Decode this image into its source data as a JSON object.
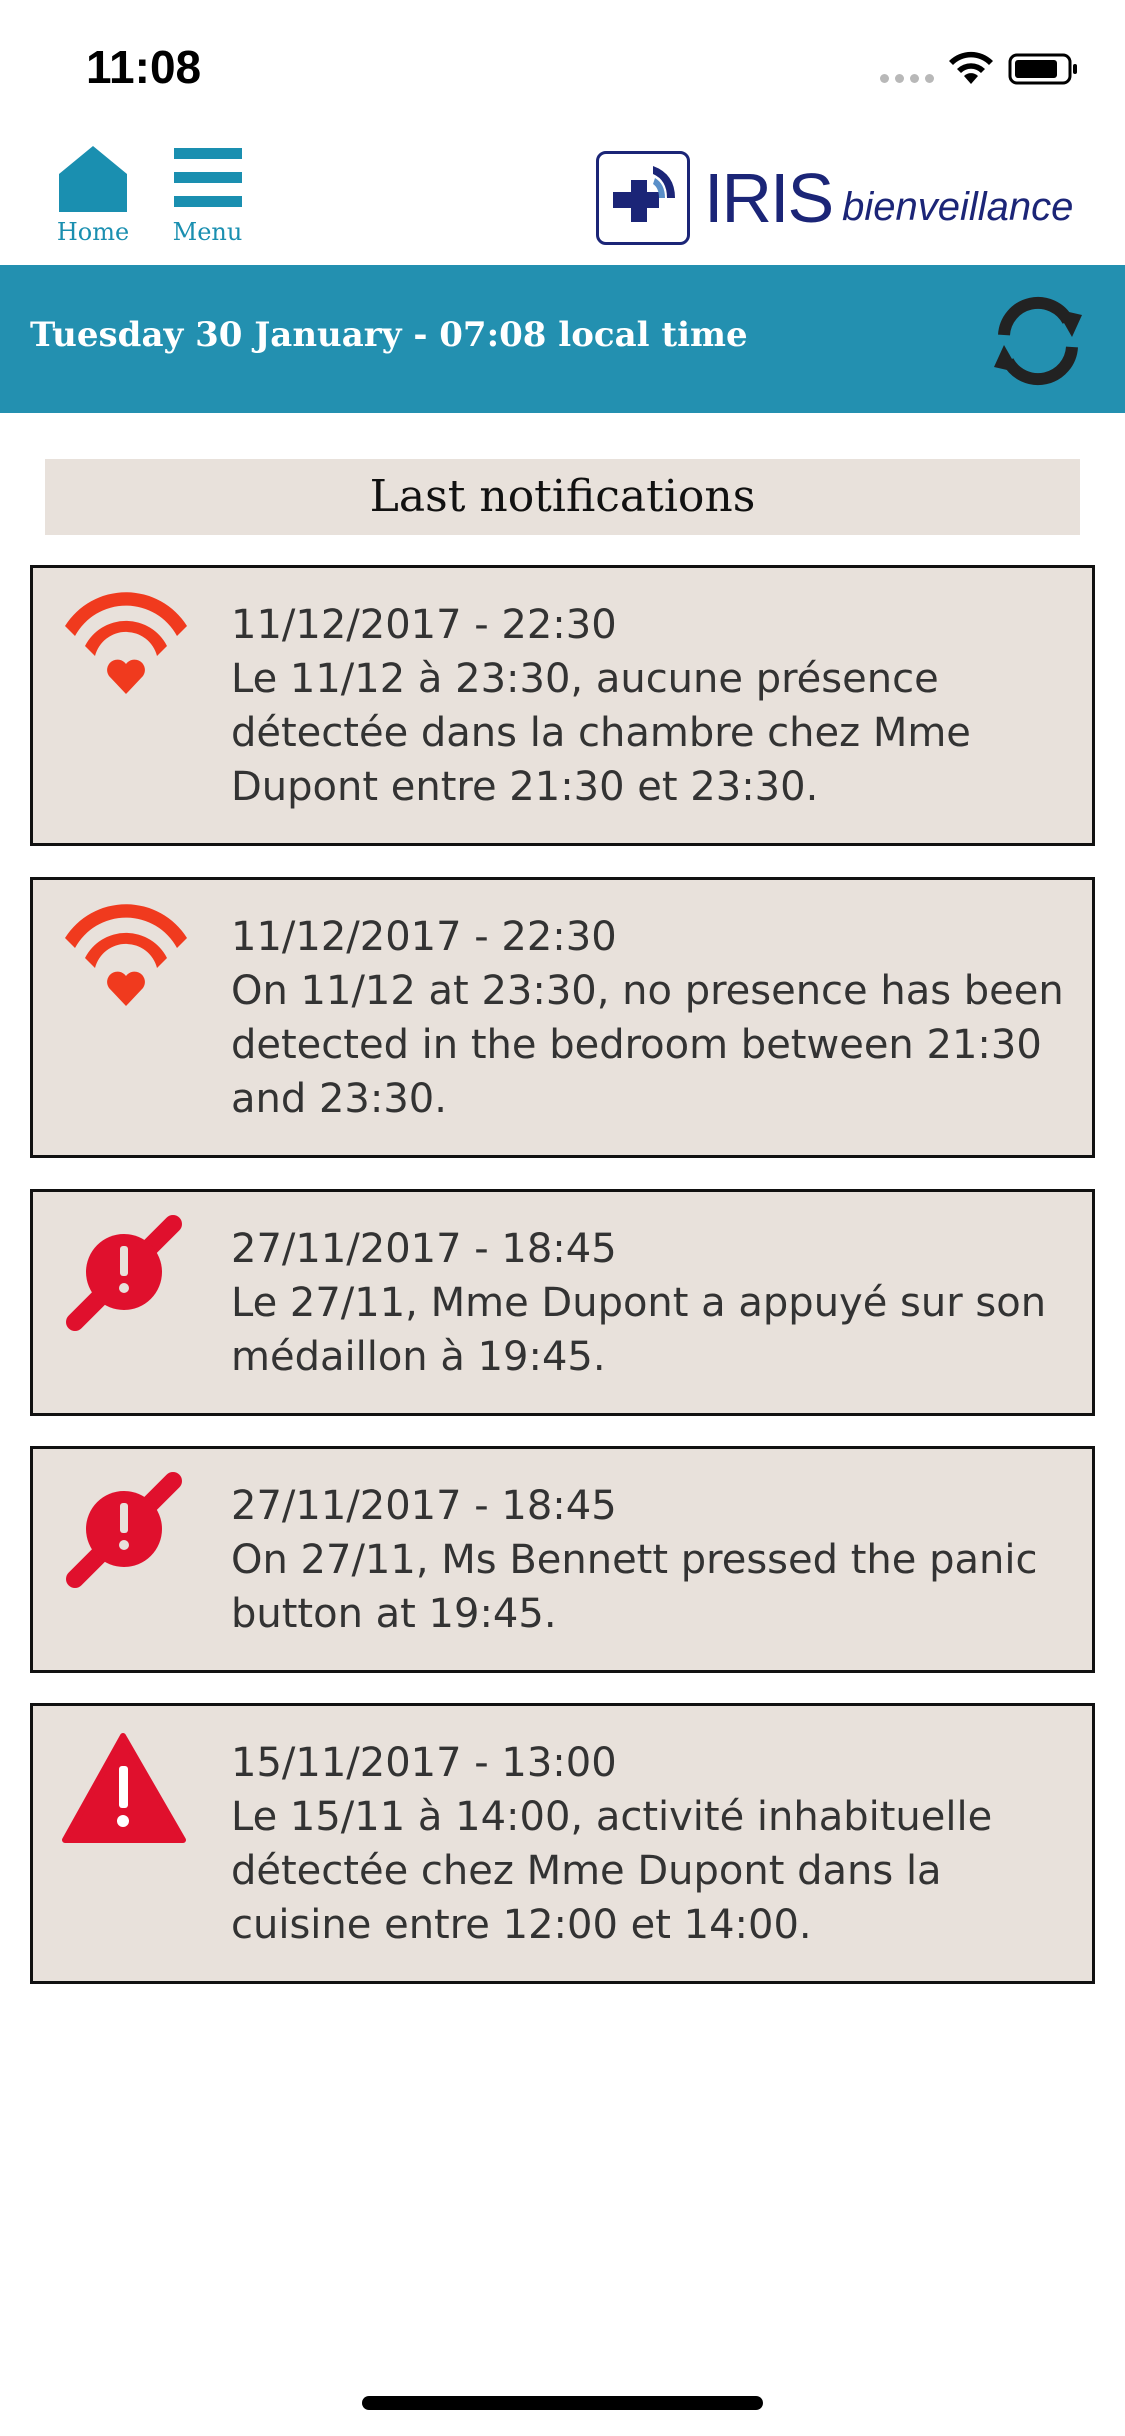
{
  "status_bar": {
    "time": "11:08"
  },
  "nav": {
    "home_label": "Home",
    "menu_label": "Menu"
  },
  "brand": {
    "name": "IRIS",
    "tagline": "bienveillance"
  },
  "banner": {
    "date_text": "Tuesday 30 January - 07:08 local time"
  },
  "section": {
    "title": "Last notifications"
  },
  "colors": {
    "accent": "#2390b0",
    "alert_red": "#e0102d",
    "presence_orange": "#f03a1e",
    "card_bg": "#e8e1db",
    "brand_navy": "#1b2577"
  },
  "notifications": [
    {
      "icon": "presence-wifi-heart-icon",
      "date": "11/12/2017 - 22:30",
      "message": "Le 11/12 à 23:30, aucune présence détectée dans la chambre chez Mme Dupont entre 21:30 et 23:30."
    },
    {
      "icon": "presence-wifi-heart-icon",
      "date": "11/12/2017 - 22:30",
      "message": "On 11/12 at 23:30, no presence has been detected in the bedroom between 21:30 and 23:30."
    },
    {
      "icon": "panic-button-icon",
      "date": "27/11/2017 - 18:45",
      "message": "Le 27/11, Mme Dupont a appuyé sur son médaillon à 19:45."
    },
    {
      "icon": "panic-button-icon",
      "date": "27/11/2017 - 18:45",
      "message": "On 27/11, Ms Bennett pressed the panic button at 19:45."
    },
    {
      "icon": "warning-triangle-icon",
      "date": "15/11/2017 - 13:00",
      "message": "Le 15/11 à 14:00, activité inhabituelle détectée chez Mme Dupont dans la cuisine entre 12:00 et 14:00."
    }
  ]
}
